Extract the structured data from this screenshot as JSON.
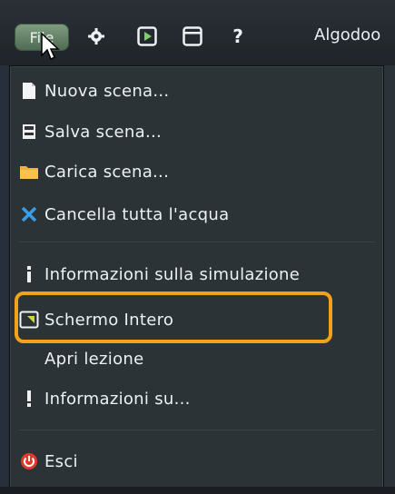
{
  "toolbar": {
    "file_label": "File",
    "app_title": "Algodoo"
  },
  "menu": {
    "items": [
      {
        "label": "Nuova scena...",
        "icon": "document-icon"
      },
      {
        "label": "Salva scena...",
        "icon": "save-icon"
      },
      {
        "label": "Carica scena...",
        "icon": "folder-icon"
      },
      {
        "label": "Cancella tutta l'acqua",
        "icon": "close-icon"
      },
      {
        "label": "Informazioni sulla simulazione",
        "icon": "info-icon"
      },
      {
        "label": "Schermo Intero",
        "icon": "fullscreen-icon"
      },
      {
        "label": "Apri lezione",
        "icon": ""
      },
      {
        "label": "Informazioni su...",
        "icon": "exclamation-icon"
      },
      {
        "label": "Esci",
        "icon": "power-icon"
      }
    ]
  },
  "colors": {
    "highlight": "#f2a21a",
    "menu_bg": "#2c3337"
  }
}
